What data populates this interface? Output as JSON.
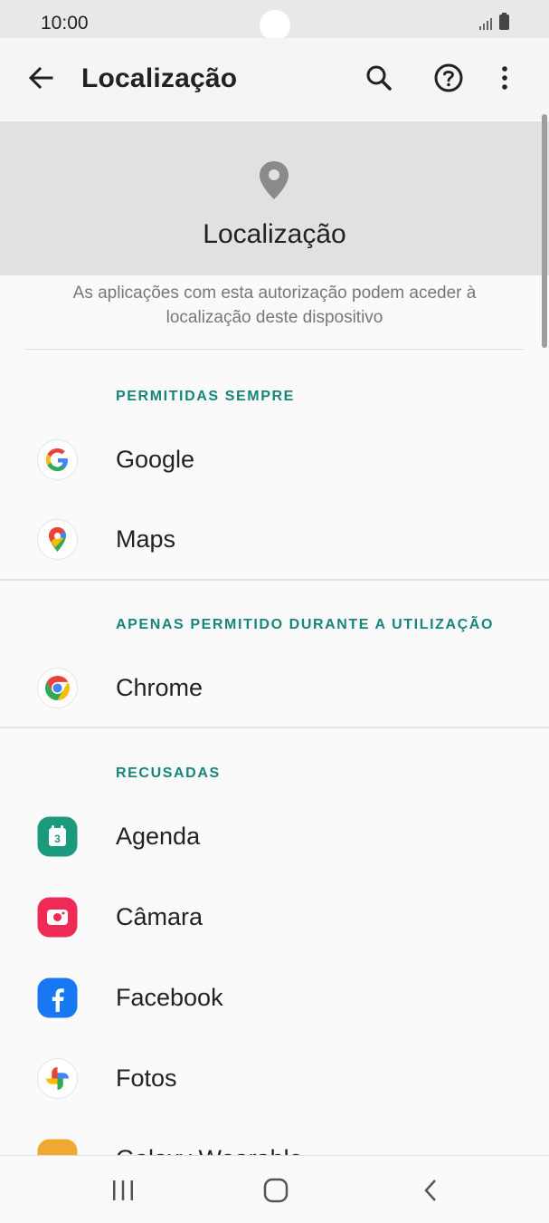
{
  "status_bar": {
    "time": "10:00"
  },
  "app_bar": {
    "title": "Localização"
  },
  "header": {
    "title": "Localização"
  },
  "description": "As aplicações com esta autorização podem aceder à localização deste dispositivo",
  "sections": [
    {
      "title": "PERMITIDAS SEMPRE",
      "apps": [
        {
          "name": "Google"
        },
        {
          "name": "Maps"
        }
      ]
    },
    {
      "title": "APENAS PERMITIDO DURANTE A UTILIZAÇÃO",
      "apps": [
        {
          "name": "Chrome"
        }
      ]
    },
    {
      "title": "RECUSADAS",
      "apps": [
        {
          "name": "Agenda",
          "badge": "3"
        },
        {
          "name": "Câmara"
        },
        {
          "name": "Facebook"
        },
        {
          "name": "Fotos"
        },
        {
          "name": "Galaxy Wearable"
        }
      ]
    }
  ],
  "colors": {
    "accent": "#17857a",
    "header_band": "#e1e1e1"
  },
  "icons": [
    "back-arrow-icon",
    "search-icon",
    "help-icon",
    "more-icon",
    "location-pin-icon",
    "google-icon",
    "maps-icon",
    "chrome-icon",
    "calendar-icon",
    "camera-icon",
    "facebook-icon",
    "photos-icon",
    "galaxy-wearable-icon",
    "recent-apps-icon",
    "home-icon",
    "nav-back-icon"
  ]
}
